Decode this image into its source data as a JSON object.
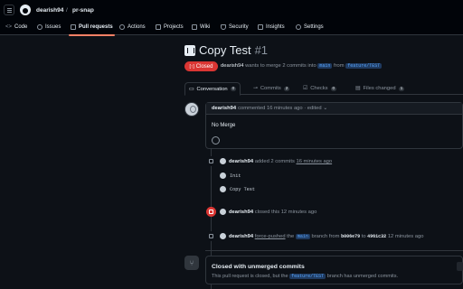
{
  "header": {
    "owner": "dearish94",
    "repo": "pr-snap"
  },
  "repo_tabs": [
    {
      "label": "Code"
    },
    {
      "label": "Issues"
    },
    {
      "label": "Pull requests"
    },
    {
      "label": "Actions"
    },
    {
      "label": "Projects"
    },
    {
      "label": "Wiki"
    },
    {
      "label": "Security"
    },
    {
      "label": "Insights"
    },
    {
      "label": "Settings"
    }
  ],
  "pr": {
    "title": "Copy Test",
    "number": "#1",
    "state": "Closed",
    "author": "dearish94",
    "meta_text": "wants to merge 2 commits into",
    "base": "main",
    "from": "from",
    "head": "feature/TEST"
  },
  "pr_tabs": [
    {
      "label": "Conversation",
      "count": "0"
    },
    {
      "label": "Commits",
      "count": "2"
    },
    {
      "label": "Checks",
      "count": "0"
    },
    {
      "label": "Files changed",
      "count": "1"
    }
  ],
  "comment": {
    "author": "dearish94",
    "time": "commented 16 minutes ago",
    "edited": "· edited",
    "body": "No Merge"
  },
  "events": {
    "commits_added": {
      "author": "dearish94",
      "text": "added 2 commits",
      "time": "16 minutes ago"
    },
    "commits": [
      "Init",
      "Copy Test"
    ],
    "closed": {
      "author": "dearish94",
      "text": "closed this 12 minutes ago"
    },
    "force_push": {
      "author": "dearish94",
      "action": "force-pushed",
      "the": "the",
      "branch": "main",
      "text1": "branch from",
      "from_hash": "b006e79",
      "to": "to",
      "to_hash": "4961c32",
      "time": "12 minutes ago"
    }
  },
  "merge_box": {
    "title": "Closed with unmerged commits",
    "desc_pre": "This pull request is closed, but the",
    "branch": "feature/TEST",
    "desc_post": "branch has unmerged commits."
  }
}
